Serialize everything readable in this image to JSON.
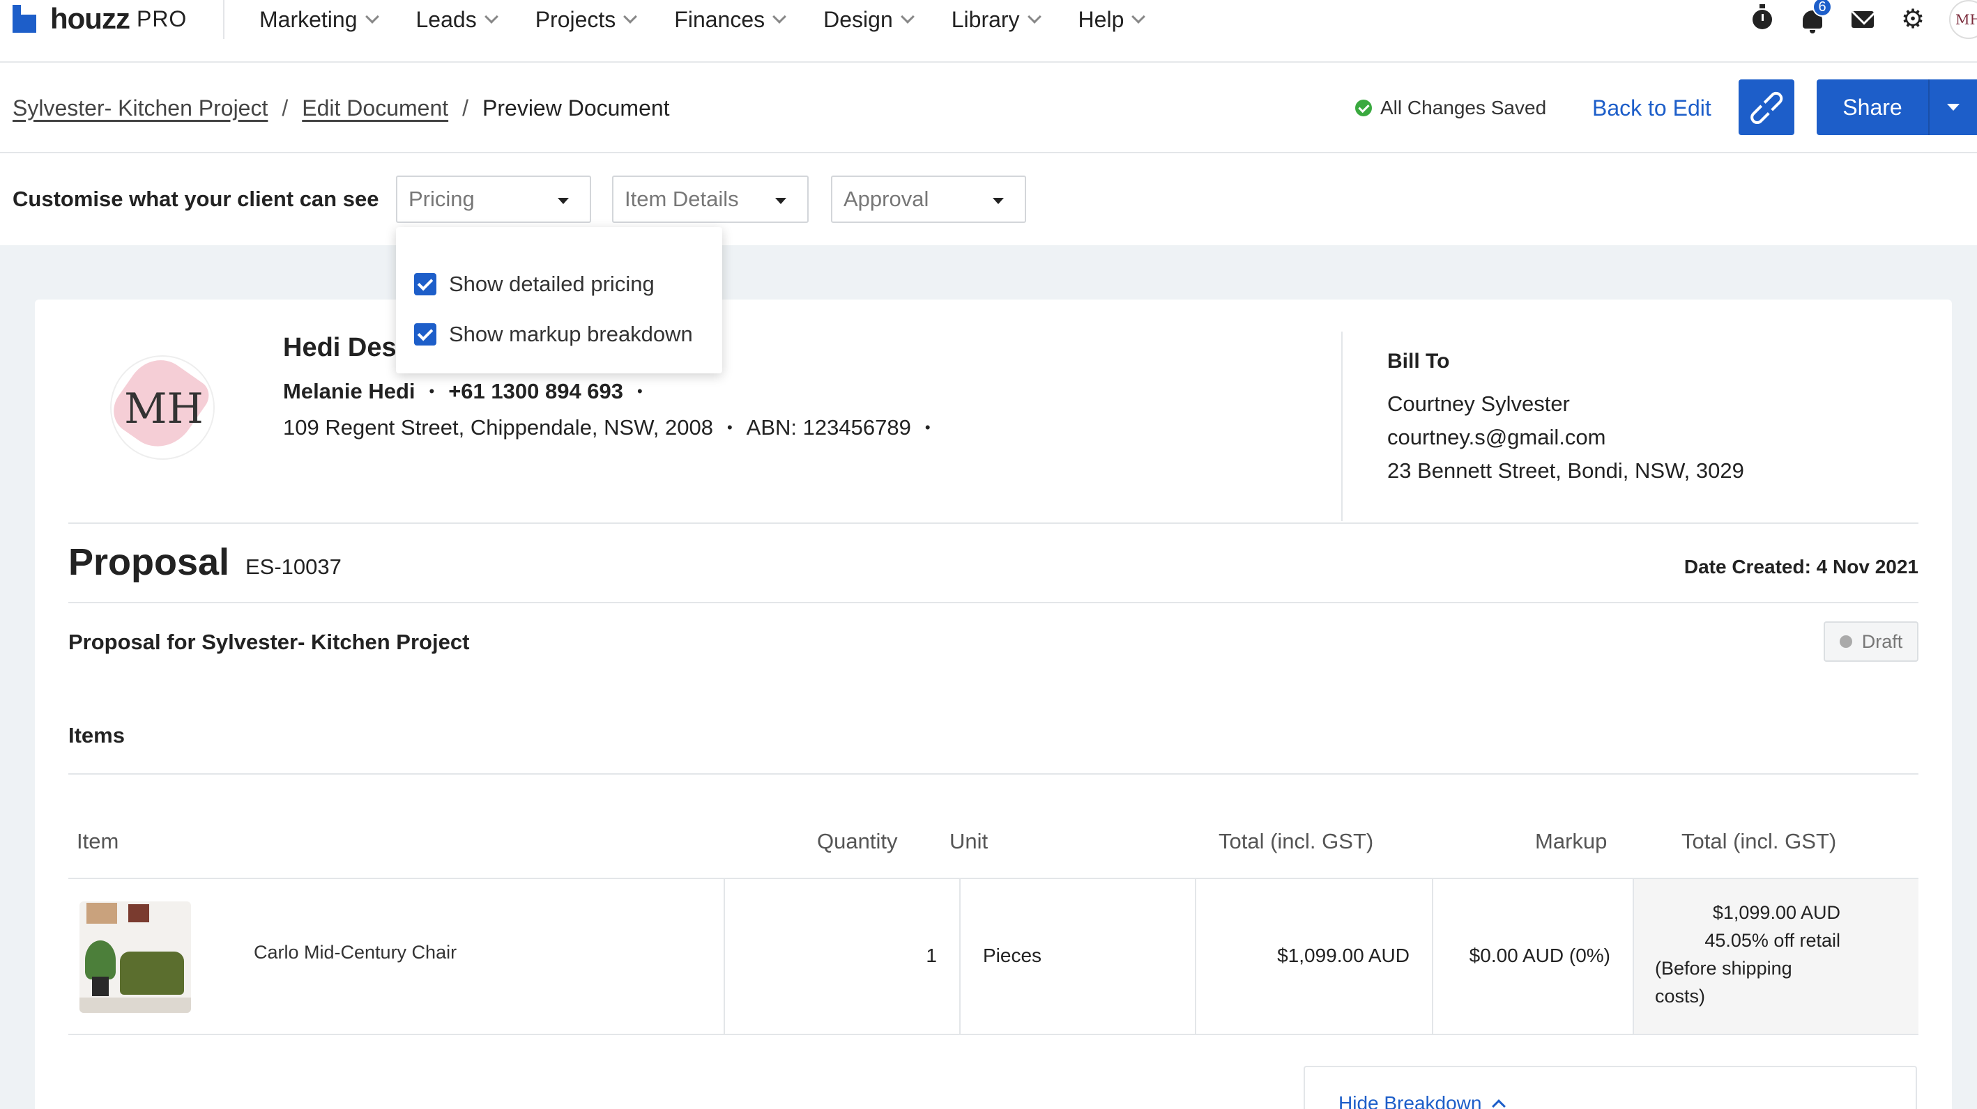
{
  "nav": {
    "logo_word": "houzz",
    "logo_pro": "PRO",
    "menu": [
      {
        "label": "Marketing"
      },
      {
        "label": "Leads"
      },
      {
        "label": "Projects"
      },
      {
        "label": "Finances"
      },
      {
        "label": "Design"
      },
      {
        "label": "Library"
      },
      {
        "label": "Help"
      }
    ],
    "notification_count": "6",
    "avatar_initials": "MH",
    "icons": [
      "timer-icon",
      "bell-icon",
      "mail-icon",
      "gear-icon"
    ]
  },
  "breadcrumb": {
    "items": [
      "Sylvester- Kitchen Project",
      "Edit Document"
    ],
    "separator": "/",
    "current": "Preview Document"
  },
  "actions": {
    "status": "All Changes Saved",
    "back_to_edit": "Back to Edit",
    "share": "Share"
  },
  "customise": {
    "label": "Customise what your client can see",
    "selects": [
      "Pricing",
      "Item Details",
      "Approval"
    ],
    "dropdown": [
      {
        "label": "Show detailed pricing",
        "checked": true
      },
      {
        "label": "Show markup breakdown",
        "checked": true
      }
    ]
  },
  "business": {
    "logo_monogram": "MH",
    "name": "Hedi Des",
    "contact_name": "Melanie Hedi",
    "phone": "+61 1300 894 693",
    "address": "109 Regent Street, Chippendale, NSW, 2008",
    "abn": "ABN: 123456789",
    "bullet": "•"
  },
  "bill_to": {
    "heading": "Bill To",
    "name": "Courtney Sylvester",
    "email": "courtney.s@gmail.com",
    "address": "23 Bennett Street, Bondi, NSW, 3029"
  },
  "proposal": {
    "title": "Proposal",
    "number": "ES-10037",
    "date_created": "Date Created: 4 Nov 2021",
    "for": "Proposal for Sylvester- Kitchen Project",
    "status": "Draft",
    "items_heading": "Items"
  },
  "table": {
    "headers": [
      "Item",
      "Quantity",
      "Unit",
      "Total (incl. GST)",
      "Markup",
      "Total (incl. GST)"
    ],
    "rows": [
      {
        "item": "Carlo Mid-Century Chair",
        "quantity": "1",
        "unit": "Pieces",
        "total": "$1,099.00 AUD",
        "markup": "$0.00 AUD (0%)",
        "final_total": "$1,099.00 AUD",
        "discount": "45.05% off retail",
        "note_1": "(Before shipping",
        "note_2": "costs)"
      }
    ],
    "hide_breakdown": "Hide Breakdown"
  },
  "colors": {
    "primary": "#1d5ec9",
    "saved": "#3aa93f",
    "background": "#eef2f5"
  }
}
